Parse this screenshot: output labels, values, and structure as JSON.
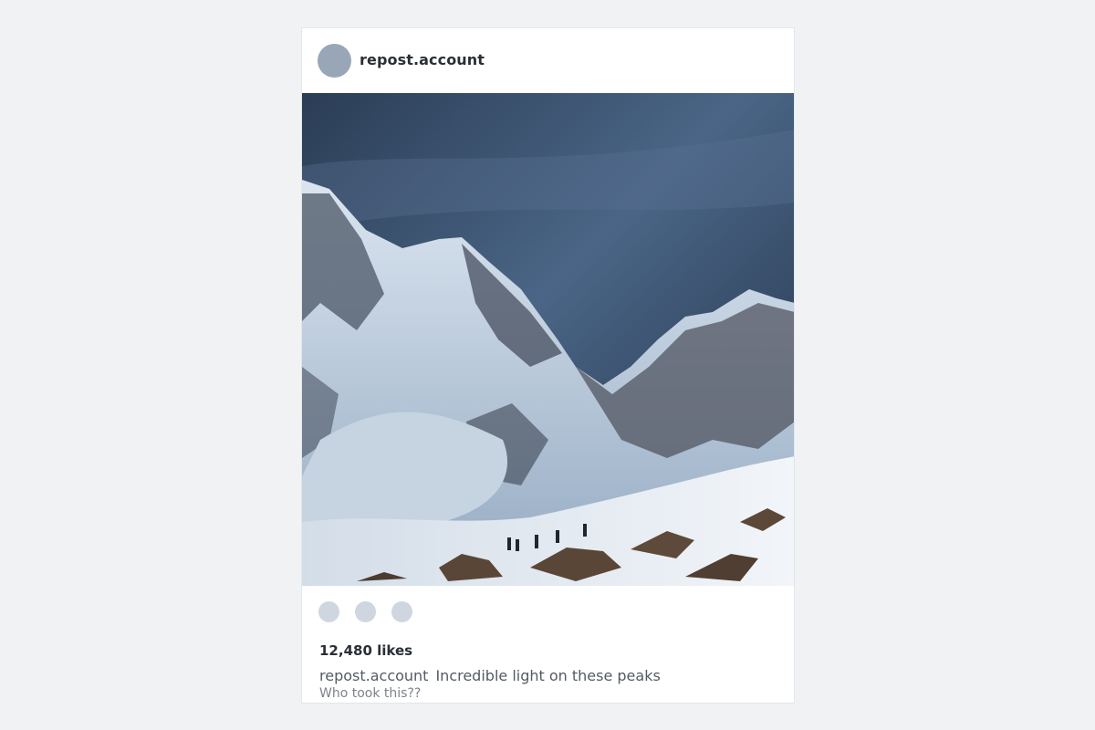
{
  "post": {
    "username": "repost.account",
    "photo_description_icon": "mountain-photo",
    "actions": [
      {
        "name": "like-button"
      },
      {
        "name": "comment-button"
      },
      {
        "name": "share-button"
      }
    ],
    "likes_text": "12,480 likes",
    "caption": {
      "username": "repost.account",
      "text": "Incredible light on these peaks"
    },
    "comment": "Who took this??"
  },
  "colors": {
    "background": "#f0f2f4",
    "avatar": "#99a6b8",
    "action_placeholder": "#cfd6e0",
    "text_dark": "#2a2f36",
    "text_muted": "#555b63"
  }
}
